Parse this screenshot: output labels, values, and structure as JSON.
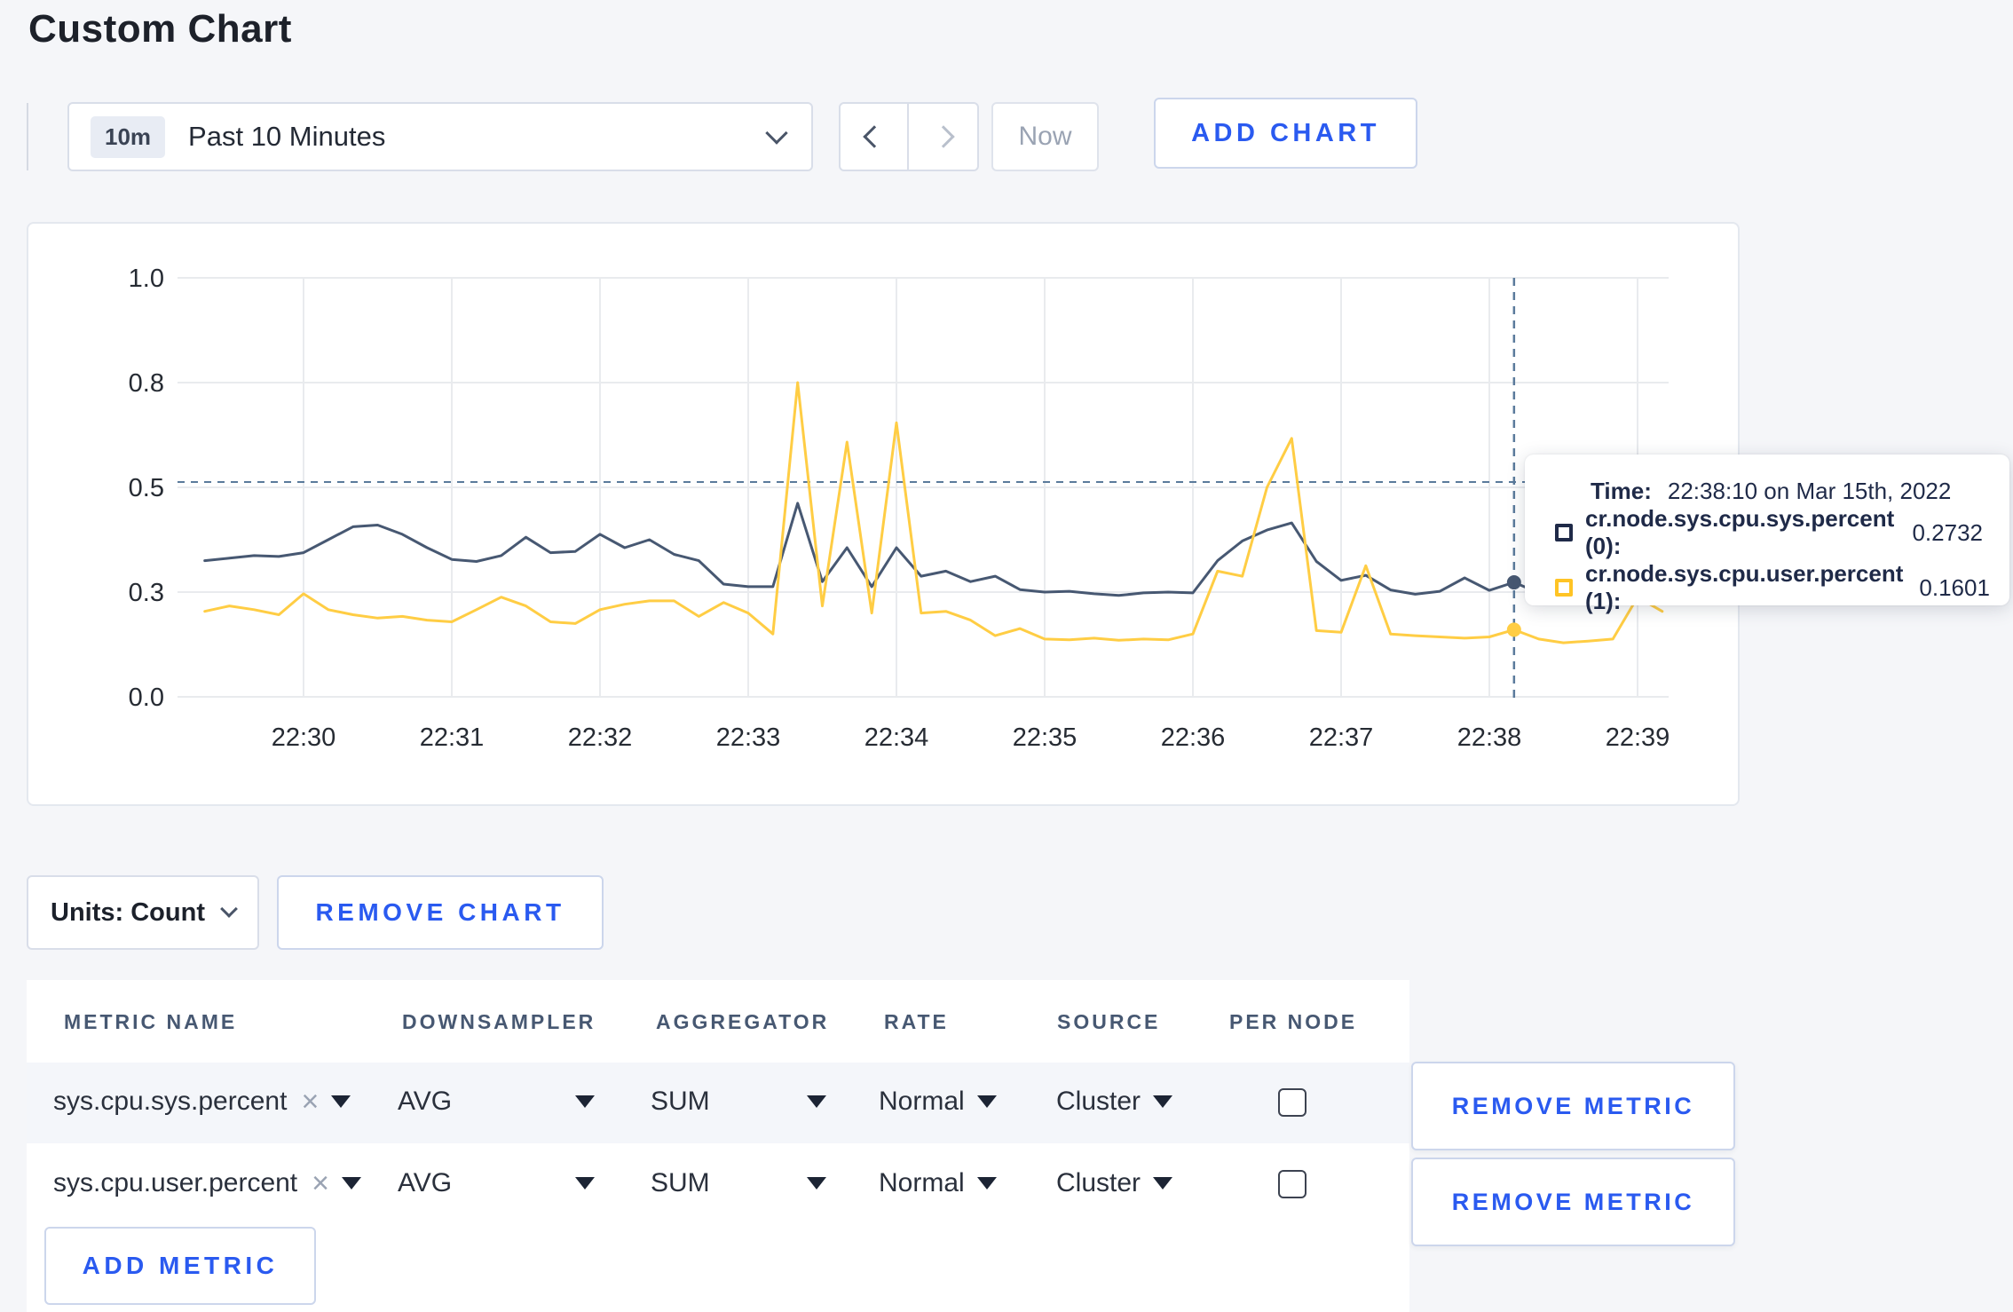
{
  "page": {
    "title": "Custom Chart"
  },
  "colors": {
    "accent_blue": "#2a5af0",
    "series_sys": "#475872",
    "series_user": "#ffcd44",
    "crosshair": "#5a7a9b",
    "gridline": "#e9ebee",
    "axis_text": "#262b33"
  },
  "toolbar": {
    "time_badge": "10m",
    "time_label": "Past 10 Minutes",
    "now_label": "Now",
    "add_chart_label": "ADD CHART"
  },
  "icons": {
    "clear_glyph": "×"
  },
  "chart_data": {
    "type": "line",
    "title": "",
    "xlabel": "",
    "ylabel": "",
    "ylim": [
      0,
      1
    ],
    "grid": true,
    "x_ticks": [
      "22:30",
      "22:31",
      "22:32",
      "22:33",
      "22:34",
      "22:35",
      "22:36",
      "22:37",
      "22:38",
      "22:39"
    ],
    "y_tick_labels": [
      "1.0",
      "0.8",
      "0.5",
      "0.3",
      "0.0"
    ],
    "y_tick_values": [
      1.0,
      0.75,
      0.5,
      0.25,
      0.0
    ],
    "start_time": "22:29:20",
    "interval_seconds": 10,
    "start_offset_min": -0.66667,
    "series": [
      {
        "name": "cr.node.sys.cpu.sys.percent",
        "color": "#475872",
        "values": [
          0.325,
          0.331,
          0.337,
          0.335,
          0.344,
          0.375,
          0.406,
          0.41,
          0.388,
          0.356,
          0.328,
          0.323,
          0.337,
          0.381,
          0.344,
          0.347,
          0.388,
          0.356,
          0.375,
          0.34,
          0.325,
          0.269,
          0.263,
          0.263,
          0.462,
          0.275,
          0.356,
          0.263,
          0.356,
          0.288,
          0.3,
          0.275,
          0.288,
          0.256,
          0.25,
          0.252,
          0.246,
          0.242,
          0.248,
          0.25,
          0.248,
          0.325,
          0.372,
          0.398,
          0.415,
          0.323,
          0.278,
          0.29,
          0.255,
          0.245,
          0.252,
          0.284,
          0.254,
          0.2732,
          0.248,
          0.272,
          0.25,
          0.25,
          0.256,
          0.263
        ]
      },
      {
        "name": "cr.node.sys.cpu.user.percent",
        "color": "#ffcd44",
        "values": [
          0.204,
          0.217,
          0.208,
          0.196,
          0.246,
          0.208,
          0.196,
          0.188,
          0.192,
          0.183,
          0.179,
          0.208,
          0.238,
          0.217,
          0.179,
          0.175,
          0.208,
          0.221,
          0.229,
          0.229,
          0.192,
          0.225,
          0.2,
          0.15,
          0.75,
          0.217,
          0.608,
          0.2,
          0.654,
          0.2,
          0.204,
          0.183,
          0.146,
          0.163,
          0.138,
          0.136,
          0.14,
          0.135,
          0.138,
          0.136,
          0.15,
          0.3,
          0.288,
          0.5,
          0.617,
          0.158,
          0.154,
          0.313,
          0.15,
          0.146,
          0.143,
          0.14,
          0.143,
          0.1601,
          0.138,
          0.129,
          0.133,
          0.138,
          0.238,
          0.204
        ]
      }
    ],
    "crosshair": {
      "time": "22:38:10",
      "index": 53,
      "guideline_value": 0.5127
    },
    "legend_position": "tooltip"
  },
  "tooltip": {
    "time_label": "Time:",
    "time_value": "22:38:10 on Mar 15th, 2022",
    "entries": [
      {
        "name": "cr.node.sys.cpu.sys.percent (0):",
        "value": "0.2732",
        "color": "#1f2a48"
      },
      {
        "name": "cr.node.sys.cpu.user.percent (1):",
        "value": "0.1601",
        "color": "#ffc425"
      }
    ]
  },
  "units_bar": {
    "units_label": "Units: Count",
    "remove_chart_label": "REMOVE CHART"
  },
  "metrics_table": {
    "headers": [
      "METRIC NAME",
      "DOWNSAMPLER",
      "AGGREGATOR",
      "RATE",
      "SOURCE",
      "PER NODE"
    ],
    "rows": [
      {
        "metric": "sys.cpu.sys.percent",
        "downsampler": "AVG",
        "aggregator": "SUM",
        "rate": "Normal",
        "source": "Cluster",
        "per_node_checked": false,
        "remove_label": "REMOVE METRIC"
      },
      {
        "metric": "sys.cpu.user.percent",
        "downsampler": "AVG",
        "aggregator": "SUM",
        "rate": "Normal",
        "source": "Cluster",
        "per_node_checked": false,
        "remove_label": "REMOVE METRIC"
      }
    ],
    "add_metric_label": "ADD METRIC"
  }
}
